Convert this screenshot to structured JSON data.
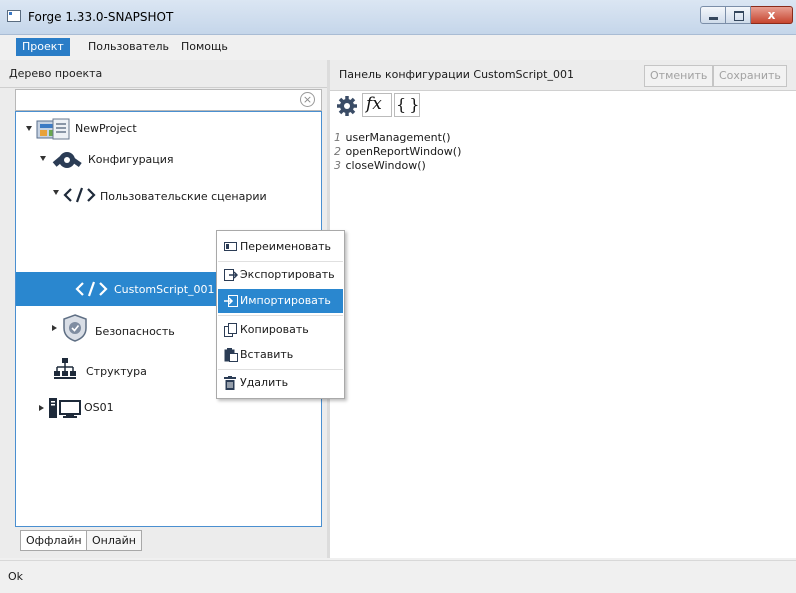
{
  "window": {
    "title": "Forge 1.33.0-SNAPSHOT",
    "close_glyph": "x"
  },
  "menubar": {
    "items": [
      "Проект",
      "Пользователь",
      "Помощь"
    ]
  },
  "left_panel": {
    "title": "Дерево проекта",
    "search": {
      "value": "",
      "placeholder": ""
    },
    "tree": {
      "project": "NewProject",
      "config": "Конфигурация",
      "user_scripts": "Пользовательские сценарии",
      "script": "CustomScript_001",
      "security": "Безопасность",
      "structure": "Структура",
      "os": "OS01"
    },
    "tabs": [
      "Оффлайн",
      "Онлайн"
    ]
  },
  "right_panel": {
    "title": "Панель конфигурации CustomScript_001",
    "cancel": "Отменить",
    "save": "Сохранить",
    "toolbar": {
      "fx": "fx",
      "braces": "{ }"
    },
    "code": [
      {
        "n": "1",
        "text": "userManagement()"
      },
      {
        "n": "2",
        "text": "openReportWindow()"
      },
      {
        "n": "3",
        "text": "closeWindow()"
      }
    ]
  },
  "context_menu": {
    "items": [
      "Переименовать",
      "Экспортировать",
      "Импортировать",
      "Копировать",
      "Вставить",
      "Удалить"
    ],
    "highlighted": "Импортировать"
  },
  "status": {
    "text": "Ok"
  },
  "colors": {
    "accent": "#2a87cf",
    "tree_border": "#4a8fd0",
    "menu_active": "#2a7dc7"
  }
}
